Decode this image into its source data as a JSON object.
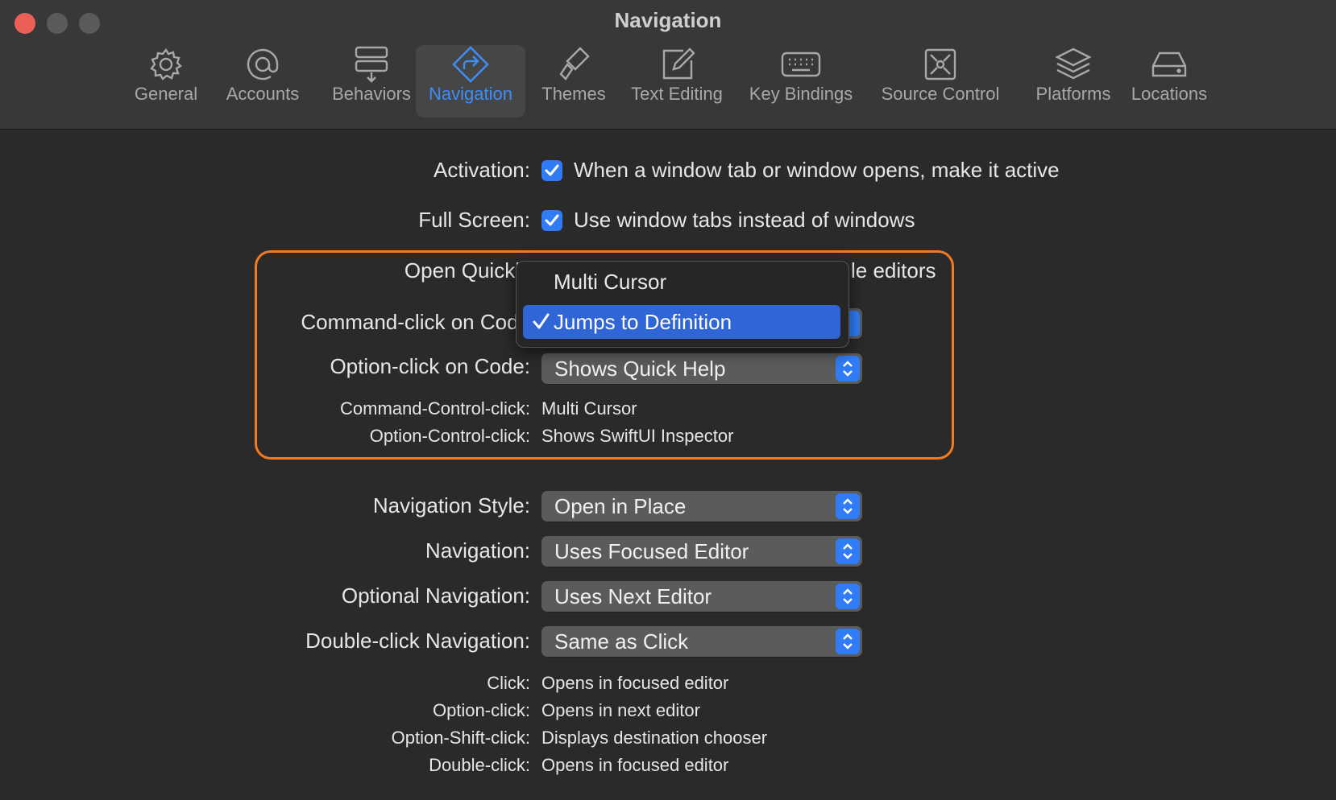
{
  "window": {
    "title": "Navigation",
    "traffic_lights": {
      "close": "#ec5f57",
      "minimize": "#5a5a5a",
      "zoom": "#5a5a5a"
    }
  },
  "toolbar": {
    "tabs": [
      {
        "label": "General",
        "icon": "gear-icon"
      },
      {
        "label": "Accounts",
        "icon": "at-sign-icon"
      },
      {
        "label": "Behaviors",
        "icon": "behaviors-icon"
      },
      {
        "label": "Navigation",
        "icon": "navigation-arrow-icon",
        "selected": true
      },
      {
        "label": "Themes",
        "icon": "brush-icon"
      },
      {
        "label": "Text Editing",
        "icon": "pencil-square-icon"
      },
      {
        "label": "Key Bindings",
        "icon": "keyboard-icon"
      },
      {
        "label": "Source Control",
        "icon": "source-control-icon"
      },
      {
        "label": "Platforms",
        "icon": "layers-icon"
      },
      {
        "label": "Locations",
        "icon": "drive-icon"
      }
    ]
  },
  "settings": {
    "activation": {
      "label": "Activation:",
      "text": "When a window tab or window opens, make it active",
      "checked": true
    },
    "full_screen": {
      "label": "Full Screen:",
      "text": "Use window tabs instead of windows",
      "checked": true
    },
    "open_quickly": {
      "label": "Open Quickly",
      "text_tail": "le editors"
    },
    "command_click": {
      "label": "Command-click on Code"
    },
    "option_click": {
      "label": "Option-click on Code:",
      "value": "Shows Quick Help"
    },
    "command_control_click": {
      "label": "Command-Control-click:",
      "value": "Multi Cursor"
    },
    "option_control_click": {
      "label": "Option-Control-click:",
      "value": "Shows SwiftUI Inspector"
    },
    "navigation_style": {
      "label": "Navigation Style:",
      "value": "Open in Place"
    },
    "navigation": {
      "label": "Navigation:",
      "value": "Uses Focused Editor"
    },
    "optional_navigation": {
      "label": "Optional Navigation:",
      "value": "Uses Next Editor"
    },
    "double_click_navigation": {
      "label": "Double-click Navigation:",
      "value": "Same as Click"
    },
    "summary": [
      {
        "label": "Click:",
        "value": "Opens in focused editor"
      },
      {
        "label": "Option-click:",
        "value": "Opens in next editor"
      },
      {
        "label": "Option-Shift-click:",
        "value": "Displays destination chooser"
      },
      {
        "label": "Double-click:",
        "value": "Opens in focused editor"
      }
    ]
  },
  "dropdown_menu": {
    "items": [
      {
        "label": "Multi Cursor",
        "selected": false
      },
      {
        "label": "Jumps to Definition",
        "selected": true
      }
    ]
  },
  "colors": {
    "accent": "#2f7cf6",
    "highlight_border": "#f47b22",
    "selected_tab_text": "#3e8ef7"
  }
}
